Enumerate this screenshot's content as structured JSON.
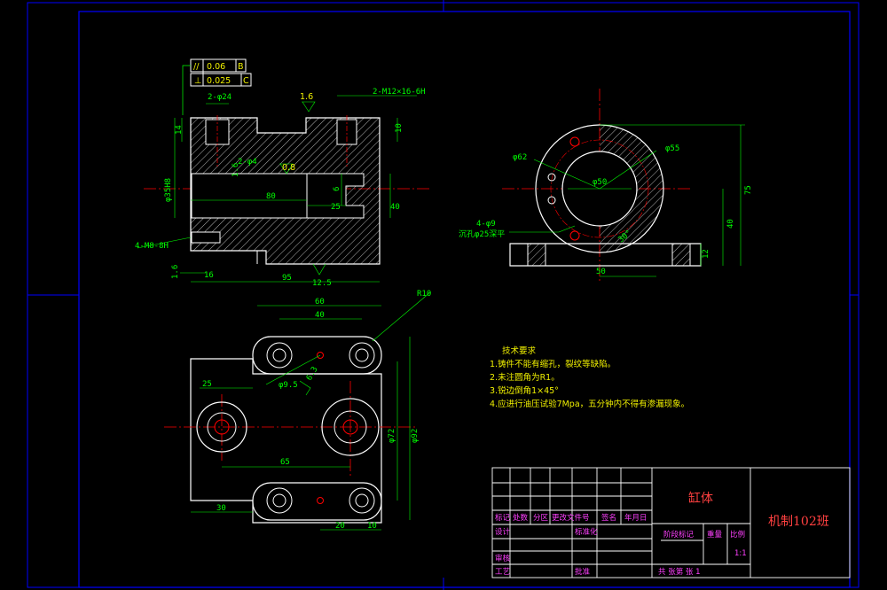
{
  "colors": {
    "background": "#000000",
    "frame": "#0000ff",
    "outline": "#ffffff",
    "dimension": "#00ff00",
    "centerline": "#ff0000",
    "note": "#f0f000",
    "titleblock_text": "#ff40ff"
  },
  "tolerance_frame": {
    "row1_symbol": "//",
    "row1_value": "0.06",
    "row1_datum": "B",
    "row2_symbol": "⊥",
    "row2_value": "0.025",
    "row2_datum": "C"
  },
  "front_view": {
    "dims": {
      "counterbore": "2-φ24",
      "thread": "2-M12×16-6H",
      "roughness_top": "1.6",
      "roughness_mid": "0.8",
      "roughness_side": "1.6",
      "small_hole": "2-φ4",
      "bore": "φ35H8",
      "length_80": "80",
      "length_95": "95",
      "length_16": "16",
      "height_14": "14",
      "height_10": "10",
      "dim_25": "25",
      "dim_40": "40",
      "dim_6": "6",
      "side_holes": "4-M8-8H",
      "roughness_bottom": "12.5",
      "left_rough": "1.6"
    }
  },
  "side_view": {
    "dims": {
      "d62": "φ62",
      "d55": "φ55",
      "d50": "φ50",
      "holes": "4-φ9",
      "counterbore_note": "沉孔φ25深平",
      "h75": "75",
      "h40": "40",
      "w50": "50",
      "h12": "12",
      "angle": "30°"
    }
  },
  "top_view": {
    "dims": {
      "w60": "60",
      "w40": "40",
      "r10": "R10",
      "w25": "25",
      "d9_5": "φ9.5",
      "w65": "65",
      "w30": "30",
      "w20": "20",
      "w10": "10",
      "d72": "φ72",
      "d92": "φ92",
      "rough": "6.3"
    }
  },
  "technical_requirements": {
    "title": "技术要求",
    "items": [
      "1.铸件不能有缩孔，裂纹等缺陷。",
      "2.未注圆角为R1。",
      "3.锐边倒角1×45°",
      "4.应进行油压试验7Mpa，五分钟内不得有渗漏现象。"
    ]
  },
  "title_block": {
    "part_name": "缸体",
    "class_name": "机制102班",
    "row_labels": [
      "标记",
      "处数",
      "分区",
      "更改文件号",
      "签名",
      "年月日"
    ],
    "design": "设计",
    "standardize": "标准化",
    "stage_mark": "阶段标记",
    "weight": "重量",
    "scale": "比例",
    "scale_value": "1:1",
    "review": "审核",
    "process": "工艺",
    "approve": "批准",
    "sheets": "共   张第   张  1"
  }
}
